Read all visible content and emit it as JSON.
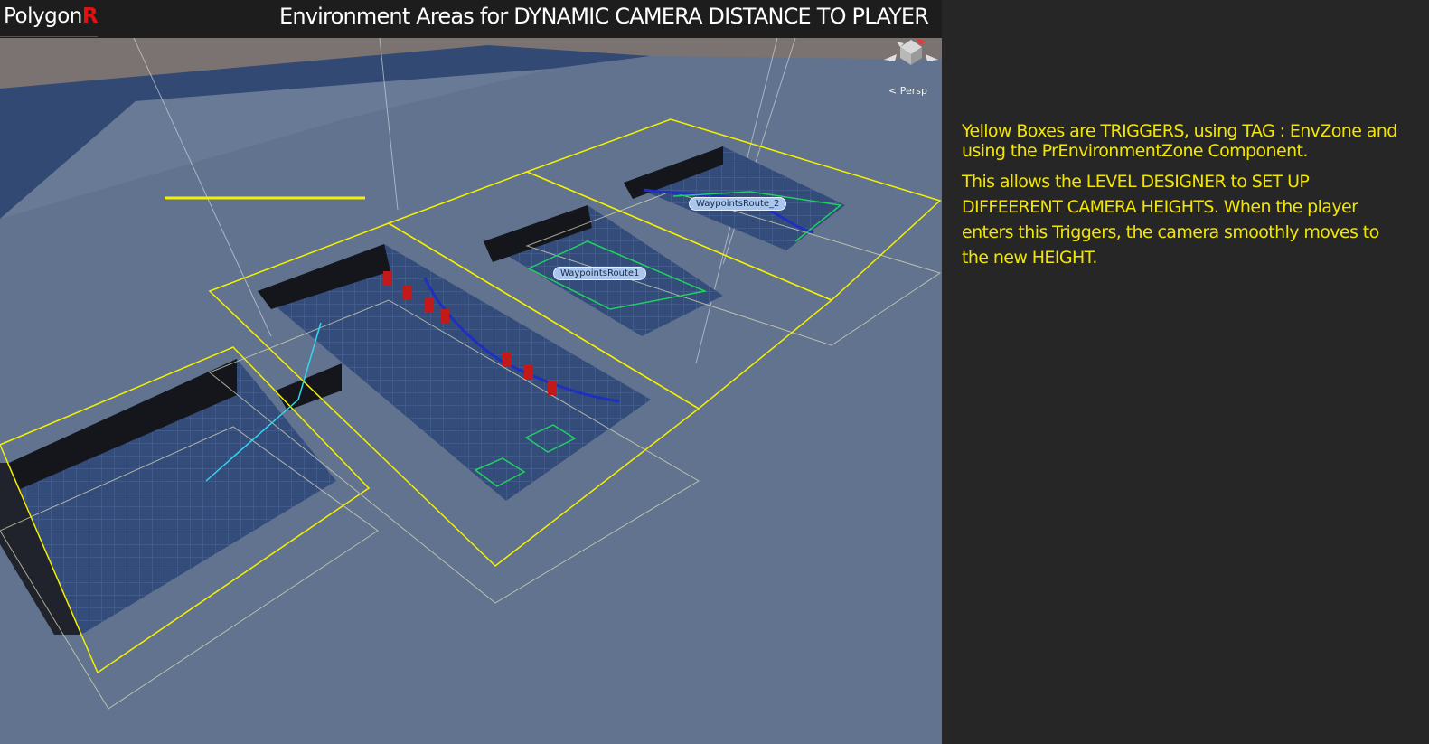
{
  "header": {
    "logo_text": "Polygon",
    "logo_accent": "R",
    "title": "Environment Areas for DYNAMIC CAMERA DISTANCE TO PLAYER"
  },
  "scene_view": {
    "projection_label": "Persp",
    "gizmo_icon": "scene-orientation-gizmo",
    "waypoint_labels": [
      "WaypointsRoute1",
      "WaypointsRoute_2"
    ]
  },
  "info_panel": {
    "paragraph_1": "Yellow Boxes are TRIGGERS, using TAG : EnvZone and using the PrEnvironmentZone Component.",
    "paragraph_2": "This allows the LEVEL DESIGNER to SET UP DIFFEERENT CAMERA HEIGHTS. When the player enters this Triggers, the camera smoothly moves to the new HEIGHT."
  },
  "colors": {
    "background": "#262626",
    "header_bar": "#1d1d1d",
    "viewport_ground": "#63758f",
    "trigger_outline": "#f5f000",
    "info_text": "#f2e600",
    "logo_accent": "#e01212",
    "waypoint_label_bg": "#a9c6ee"
  }
}
